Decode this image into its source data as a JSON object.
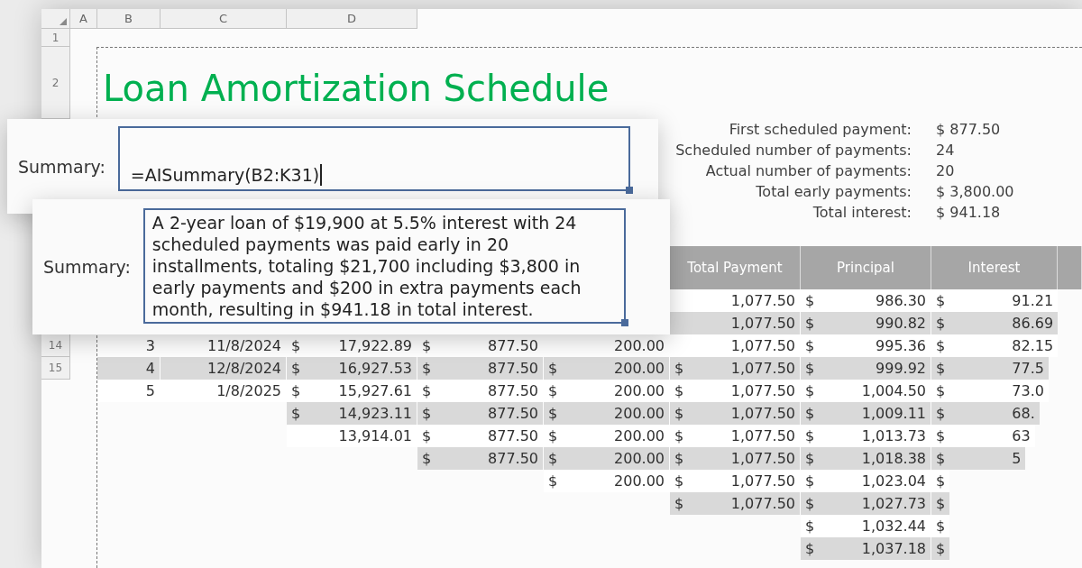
{
  "sheet": {
    "column_headers": [
      "A",
      "B",
      "C",
      "D"
    ],
    "row_headers": [
      "1",
      "2"
    ],
    "title": "Loan Amortization Schedule",
    "facts": [
      {
        "label": "First scheduled payment:",
        "value": "$ 877.50"
      },
      {
        "label": "Scheduled number of payments:",
        "value": "24"
      },
      {
        "label": "Actual number of payments:",
        "value": "20"
      },
      {
        "label": "Total early payments:",
        "value": "$ 3,800.00"
      },
      {
        "label": "Total interest:",
        "value": "$ 941.18"
      }
    ],
    "table": {
      "header": {
        "total_payment": "Total Payment",
        "principal": "Principal",
        "interest": "Interest"
      },
      "rows": [
        {
          "total_payment": {
            "value": "1,077.50"
          },
          "principal": {
            "symbol": "$",
            "value": "986.30"
          },
          "interest": {
            "symbol": "$",
            "value": "91.21"
          }
        },
        {
          "total_payment": {
            "value": "1,077.50"
          },
          "principal": {
            "symbol": "$",
            "value": "990.82"
          },
          "interest": {
            "symbol": "$",
            "value": "86.69"
          }
        },
        {
          "row_header": "14",
          "column_1": "3",
          "column_2": "11/8/2024",
          "column_3": {
            "symbol": "$",
            "value": "17,922.89"
          },
          "column_4": {
            "symbol": "$",
            "value": "877.50"
          },
          "column_5": {
            "value": "200.00"
          },
          "total_payment": {
            "value": "1,077.50"
          },
          "principal": {
            "symbol": "$",
            "value": "995.36"
          },
          "interest": {
            "symbol": "$",
            "value": "82.15"
          }
        },
        {
          "row_header": "15",
          "column_1": "4",
          "column_2": "12/8/2024",
          "column_3": {
            "symbol": "$",
            "value": "16,927.53"
          },
          "column_4": {
            "symbol": "$",
            "value": "877.50"
          },
          "column_5": {
            "symbol": "$",
            "value": "200.00"
          },
          "total_payment": {
            "symbol": "$",
            "value": "1,077.50"
          },
          "principal": {
            "symbol": "$",
            "value": "999.92"
          },
          "interest": {
            "symbol": "$",
            "value": "77.5"
          }
        },
        {
          "column_1": "5",
          "column_2": "1/8/2025",
          "column_3": {
            "symbol": "$",
            "value": "15,927.61"
          },
          "column_4": {
            "symbol": "$",
            "value": "877.50"
          },
          "column_5": {
            "symbol": "$",
            "value": "200.00"
          },
          "total_payment": {
            "symbol": "$",
            "value": "1,077.50"
          },
          "principal": {
            "symbol": "$",
            "value": "1,004.50"
          },
          "interest": {
            "symbol": "$",
            "value": "73.0"
          }
        },
        {
          "column_3": {
            "symbol": "$",
            "value": "14,923.11"
          },
          "column_4": {
            "symbol": "$",
            "value": "877.50"
          },
          "column_5": {
            "symbol": "$",
            "value": "200.00"
          },
          "total_payment": {
            "symbol": "$",
            "value": "1,077.50"
          },
          "principal": {
            "symbol": "$",
            "value": "1,009.11"
          },
          "interest": {
            "symbol": "$",
            "value": "68."
          }
        },
        {
          "column_3": {
            "value": "13,914.01"
          },
          "column_4": {
            "symbol": "$",
            "value": "877.50"
          },
          "column_5": {
            "symbol": "$",
            "value": "200.00"
          },
          "total_payment": {
            "symbol": "$",
            "value": "1,077.50"
          },
          "principal": {
            "symbol": "$",
            "value": "1,013.73"
          },
          "interest": {
            "symbol": "$",
            "value": "63"
          }
        },
        {
          "column_4": {
            "symbol": "$",
            "value": "877.50"
          },
          "column_5": {
            "symbol": "$",
            "value": "200.00"
          },
          "total_payment": {
            "symbol": "$",
            "value": "1,077.50"
          },
          "principal": {
            "symbol": "$",
            "value": "1,018.38"
          },
          "interest": {
            "symbol": "$",
            "value": "5"
          }
        },
        {
          "column_5": {
            "symbol": "$",
            "value": "200.00"
          },
          "total_payment": {
            "symbol": "$",
            "value": "1,077.50"
          },
          "principal": {
            "symbol": "$",
            "value": "1,023.04"
          },
          "interest": {
            "symbol": "$"
          }
        },
        {
          "total_payment": {
            "symbol": "$",
            "value": "1,077.50"
          },
          "principal": {
            "symbol": "$",
            "value": "1,027.73"
          },
          "interest": {
            "symbol": "$"
          }
        },
        {
          "principal": {
            "symbol": "$",
            "value": "1,032.44"
          },
          "interest": {
            "symbol": "$"
          }
        },
        {
          "principal": {
            "symbol": "$",
            "value": "1,037.18"
          },
          "interest": {
            "symbol": "$"
          }
        }
      ]
    }
  },
  "panels": [
    {
      "label": "Summary:",
      "field": {
        "value": "=AISummary(B2:K31)",
        "focused": true
      }
    },
    {
      "label": "Summary:",
      "field": {
        "value": "A 2-year loan of $19,900 at 5.5% interest with 24 scheduled payments was paid early in 20 installments, totaling $21,700 including $3,800 in early payments and $200 in extra payments each month, resulting in $941.18 in total interest.",
        "focused": false
      }
    }
  ]
}
